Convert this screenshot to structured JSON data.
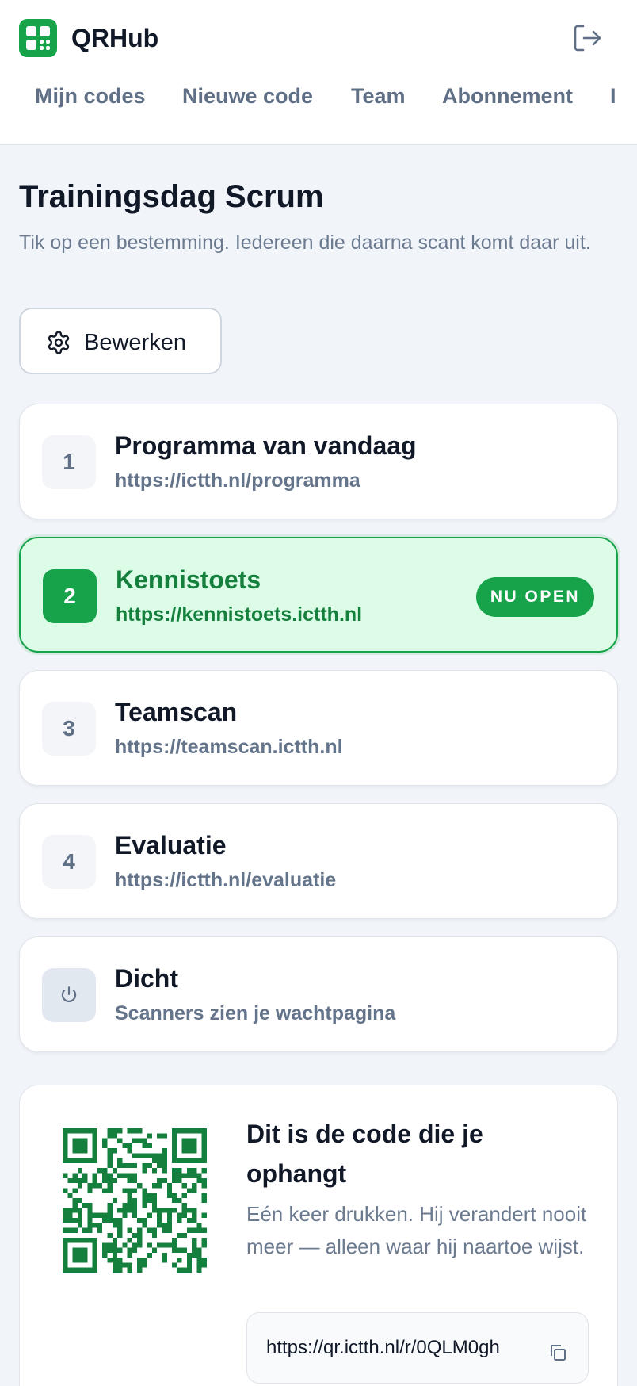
{
  "app": {
    "title": "QRHub"
  },
  "nav": {
    "items": [
      {
        "label": "Mijn codes"
      },
      {
        "label": "Nieuwe code"
      },
      {
        "label": "Team"
      },
      {
        "label": "Abonnement"
      },
      {
        "label": "I"
      }
    ]
  },
  "page": {
    "title": "Trainingsdag Scrum",
    "subtitle": "Tik op een bestemming. Iedereen die daarna scant komt daar uit.",
    "edit_label": "Bewerken"
  },
  "destinations": [
    {
      "number": "1",
      "title": "Programma van vandaag",
      "url": "https://ictth.nl/programma",
      "active": false
    },
    {
      "number": "2",
      "title": "Kennistoets",
      "url": "https://kennistoets.ictth.nl",
      "active": true,
      "badge": "NU OPEN"
    },
    {
      "number": "3",
      "title": "Teamscan",
      "url": "https://teamscan.ictth.nl",
      "active": false
    },
    {
      "number": "4",
      "title": "Evaluatie",
      "url": "https://ictth.nl/evaluatie",
      "active": false
    }
  ],
  "closed_option": {
    "icon": "power-icon",
    "title": "Dicht",
    "description": "Scanners zien je wachtpagina"
  },
  "qr_section": {
    "title": "Dit is de code die je ophangt",
    "description": "Eén keer drukken. Hij verandert nooit meer — alleen waar hij naartoe wijst.",
    "link": "https://qr.ictth.nl/r/0QLM0gh"
  },
  "colors": {
    "accent": "#16a34a",
    "accent_dark": "#15803d",
    "active_bg": "#dcfce7",
    "muted_text": "#64748b",
    "page_bg": "#f1f4f8"
  }
}
